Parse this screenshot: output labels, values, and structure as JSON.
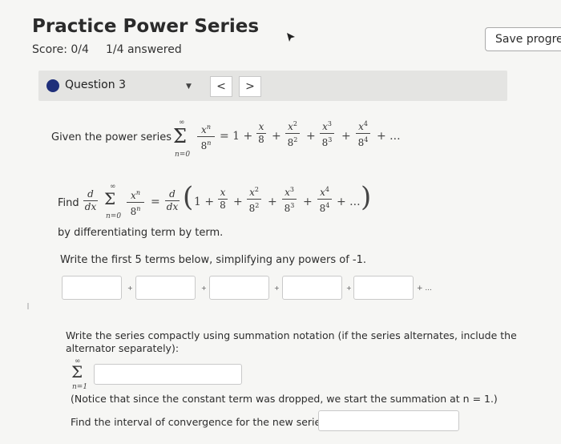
{
  "header": {
    "title": "Practice Power Series",
    "score": "Score: 0/4",
    "answered": "1/4 answered",
    "save_label": "Save progres"
  },
  "question_bar": {
    "label": "Question 3",
    "prev_label": "<",
    "next_label": ">"
  },
  "problem": {
    "given_text": "Given the power series",
    "find_text": "Find",
    "diff_text": "by differentiating term by term.",
    "write_terms_text": "Write the first 5 terms below, simplifying any powers of -1.",
    "terms_ellipsis": "+ ...",
    "compact_text": "Write the series compactly using summation notation (if the series alternates, include the alternator separately):",
    "notice_text": "(Notice that since the constant term was dropped, we start the summation at n = 1.)",
    "interval_text": "Find the interval of convergence for the new series."
  },
  "answers": {
    "term1": "",
    "term2": "",
    "term3": "",
    "term4": "",
    "term5": "",
    "summation": "",
    "interval": ""
  },
  "math": {
    "sum_top": "∞",
    "sum_bottom_n0": "n=0",
    "sum_bottom_n1": "n=1",
    "general_num": "x",
    "general_den": "8",
    "exp_n": "n",
    "equals_one_plus": "= 1 +",
    "ellipsis": "+ ...",
    "d": "d",
    "dx": "dx"
  },
  "icons": {
    "dropdown": "caret-down-icon",
    "cursor": "mouse-pointer-icon",
    "bullet": "question-dot-icon"
  },
  "colors": {
    "accent": "#1f2f7a",
    "page_bg": "#f6f6f4",
    "bar_bg": "#e4e4e2"
  }
}
